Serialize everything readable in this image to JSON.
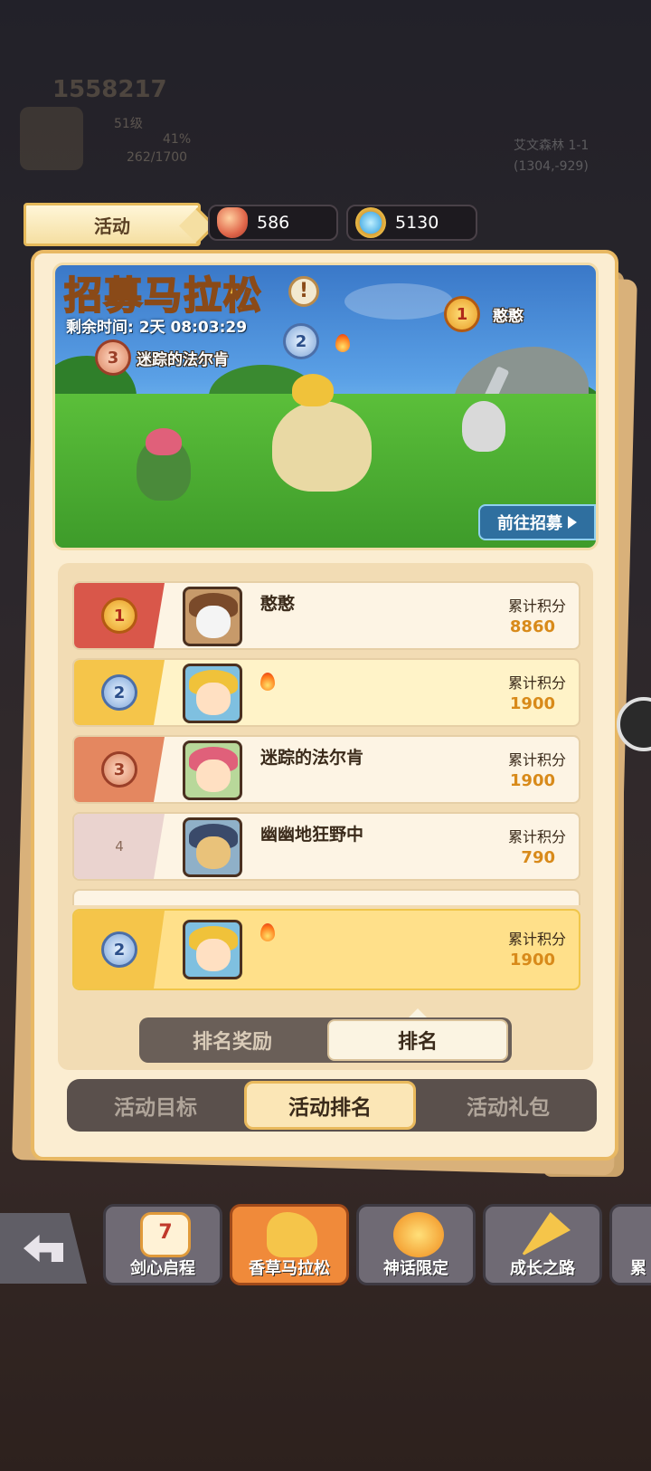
{
  "background": {
    "score": "1558217",
    "level": "51级",
    "exp_percent": "41%",
    "exp": "262/1700",
    "location": "艾文森林 1-1",
    "coords": "(1304,-929)"
  },
  "header": {
    "tab_label": "活动",
    "currencies": [
      {
        "icon": "ruby-gem-icon",
        "value": "586"
      },
      {
        "icon": "star-coin-icon",
        "value": "5130"
      }
    ]
  },
  "banner": {
    "title": "招募马拉松",
    "remaining": "剩余时间: 2天 08:03:29",
    "first_name": "憨憨",
    "third_name": "迷踪的法尔肯",
    "badges": [
      "1",
      "2",
      "3"
    ],
    "recruit_button": "前往招募"
  },
  "ranking": {
    "rows": [
      {
        "rank": "1",
        "name": "憨憨",
        "points_label": "累计积分",
        "points": "8860"
      },
      {
        "rank": "2",
        "name": "",
        "points_label": "累计积分",
        "points": "1900"
      },
      {
        "rank": "3",
        "name": "迷踪的法尔肯",
        "points_label": "累计积分",
        "points": "1900"
      },
      {
        "rank": "4",
        "name": "幽幽地狂野中",
        "points_label": "累计积分",
        "points": "790"
      }
    ],
    "my_row": {
      "rank": "2",
      "name": "",
      "points_label": "累计积分",
      "points": "1900"
    }
  },
  "sub_tabs": [
    "排名奖励",
    "排名"
  ],
  "main_tabs": [
    "活动目标",
    "活动排名",
    "活动礼包"
  ],
  "bottom_tabs": [
    {
      "label": "剑心启程",
      "icon": "calendar-check-icon",
      "calendar_day": "7"
    },
    {
      "label": "香草马拉松",
      "icon": "horse-icon"
    },
    {
      "label": "神话限定",
      "icon": "mythic-orb-icon"
    },
    {
      "label": "成长之路",
      "icon": "party-popper-icon"
    },
    {
      "label": "累",
      "icon": "partial-icon"
    }
  ],
  "colors": {
    "panel": "#fbedd1",
    "gold_accent": "#e8b863",
    "points": "#d88a1a",
    "active_tab": "#f08a3a"
  }
}
